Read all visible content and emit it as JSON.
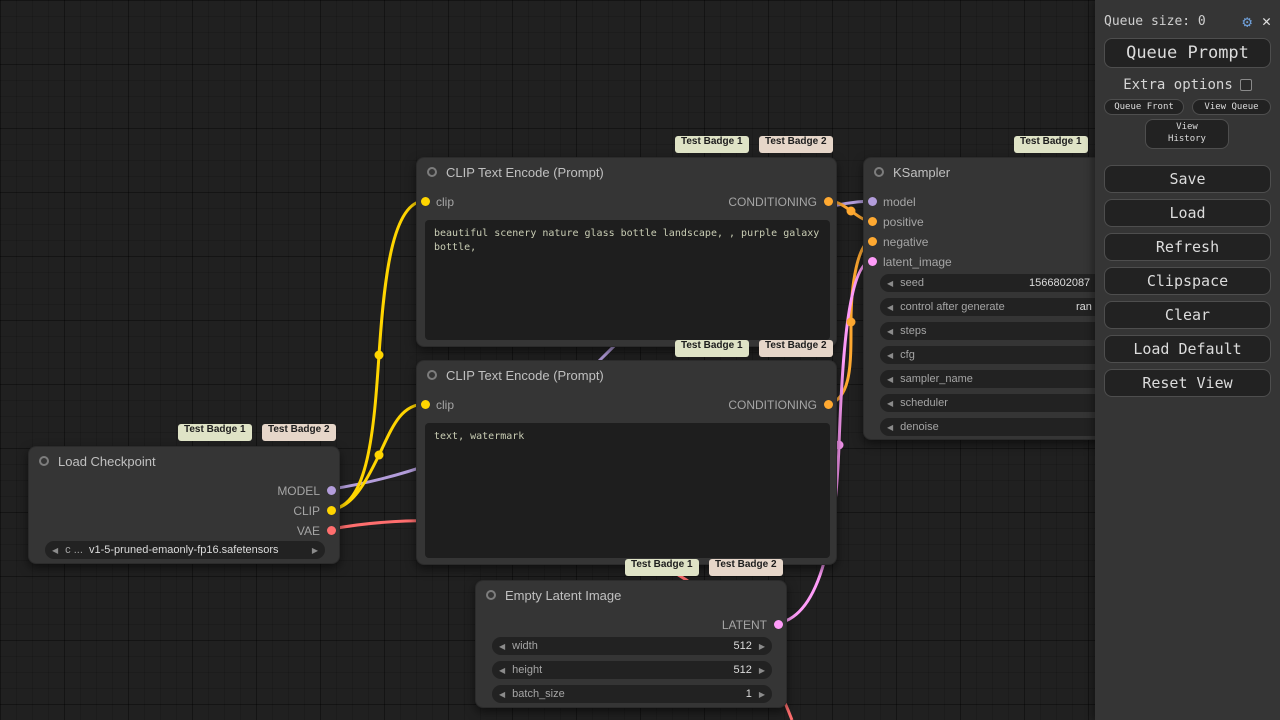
{
  "menu": {
    "queue_size": "Queue size: 0",
    "queue_prompt": "Queue Prompt",
    "extra_options": "Extra options",
    "queue_front": "Queue Front",
    "view_queue": "View Queue",
    "view_history": "View History",
    "actions": [
      "Save",
      "Load",
      "Refresh",
      "Clipspace",
      "Clear",
      "Load Default",
      "Reset View"
    ]
  },
  "badges": {
    "badge1": "Test Badge 1",
    "badge2": "Test Badge 2"
  },
  "nodes": {
    "clip_encode_1": {
      "title": "CLIP Text Encode (Prompt)",
      "input": "clip",
      "output": "CONDITIONING",
      "prompt": "beautiful scenery nature glass bottle landscape, , purple galaxy bottle,"
    },
    "clip_encode_2": {
      "title": "CLIP Text Encode (Prompt)",
      "input": "clip",
      "output": "CONDITIONING",
      "prompt": "text, watermark"
    },
    "ksampler": {
      "title": "KSampler",
      "inputs": [
        "model",
        "positive",
        "negative",
        "latent_image"
      ],
      "widgets": [
        {
          "label": "seed",
          "value": "1566802087"
        },
        {
          "label": "control after generate",
          "value": "ran"
        },
        {
          "label": "steps",
          "value": ""
        },
        {
          "label": "cfg",
          "value": ""
        },
        {
          "label": "sampler_name",
          "value": ""
        },
        {
          "label": "scheduler",
          "value": ""
        },
        {
          "label": "denoise",
          "value": ""
        }
      ]
    },
    "load_checkpoint": {
      "title": "Load Checkpoint",
      "outputs": [
        "MODEL",
        "CLIP",
        "VAE"
      ],
      "widget_label": "c ...",
      "widget_value": "v1-5-pruned-emaonly-fp16.safetensors"
    },
    "empty_latent": {
      "title": "Empty Latent Image",
      "output": "LATENT",
      "widgets": [
        {
          "label": "width",
          "value": "512"
        },
        {
          "label": "height",
          "value": "512"
        },
        {
          "label": "batch_size",
          "value": "1"
        }
      ]
    }
  },
  "colors": {
    "model": "#B39DDB",
    "clip": "#FFD500",
    "vae": "#FF6E6E",
    "conditioning": "#FFA931",
    "latent": "#FF9CF9"
  }
}
